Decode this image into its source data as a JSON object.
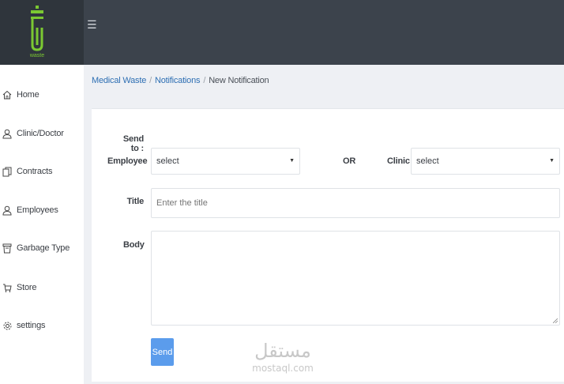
{
  "header": {
    "logo_text": "waste",
    "menu_icon": "☰"
  },
  "sidebar": {
    "items": [
      {
        "label": "Home",
        "icon": "home-icon"
      },
      {
        "label": "Clinic/Doctor",
        "icon": "user-icon"
      },
      {
        "label": "Contracts",
        "icon": "document-icon"
      },
      {
        "label": "Employees",
        "icon": "user-icon"
      },
      {
        "label": "Garbage Type",
        "icon": "trash-icon"
      },
      {
        "label": "Store",
        "icon": "cart-icon"
      },
      {
        "label": "settings",
        "icon": "gear-icon"
      }
    ]
  },
  "breadcrumb": {
    "items": [
      "Medical Waste",
      "Notifications",
      "New Notification"
    ],
    "separator": "/"
  },
  "form": {
    "send_to_label": "Send to :",
    "employee_label": "Employee",
    "employee_value": "select",
    "or_label": "OR",
    "clinic_label": "Clinic",
    "clinic_value": "select",
    "title_label": "Title",
    "title_placeholder": "Enter the title",
    "body_label": "Body",
    "send_label": "Send"
  },
  "watermark": {
    "arabic": "مستقل",
    "latin": "mostaql.com"
  },
  "colors": {
    "header_bg": "#3c434c",
    "logo_bg": "#2f353c",
    "logo_green": "#7bc832",
    "link": "#2e6fb3",
    "button": "#5b9cec"
  }
}
